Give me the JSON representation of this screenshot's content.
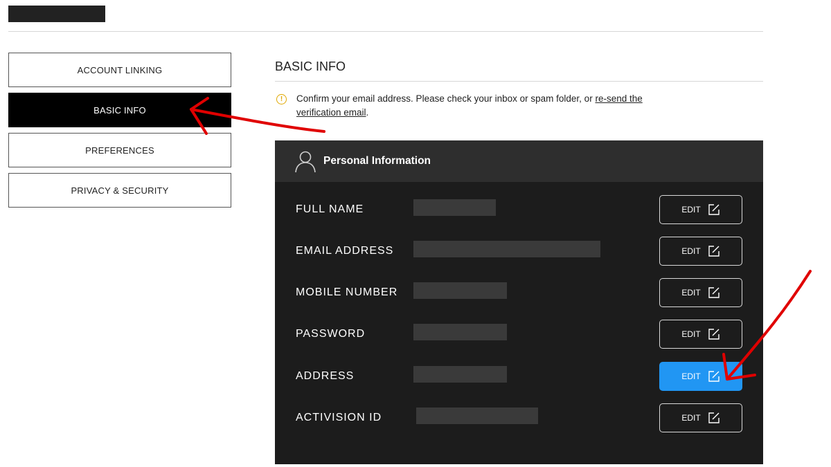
{
  "sidebar": {
    "items": [
      {
        "label": "ACCOUNT LINKING"
      },
      {
        "label": "BASIC INFO"
      },
      {
        "label": "PREFERENCES"
      },
      {
        "label": "PRIVACY & SECURITY"
      }
    ]
  },
  "main": {
    "title": "BASIC INFO",
    "notice": {
      "text": "Confirm your email address. Please check your inbox or spam folder, or ",
      "link": "re-send the verification email",
      "end": "."
    },
    "panel": {
      "title": "Personal Information",
      "rows": [
        {
          "label": "FULL NAME",
          "edit": "EDIT"
        },
        {
          "label": "EMAIL ADDRESS",
          "edit": "EDIT"
        },
        {
          "label": "MOBILE NUMBER",
          "edit": "EDIT"
        },
        {
          "label": "PASSWORD",
          "edit": "EDIT"
        },
        {
          "label": "ADDRESS",
          "edit": "EDIT"
        },
        {
          "label": "ACTIVISION ID",
          "edit": "EDIT"
        }
      ]
    }
  },
  "colors": {
    "active_nav": "#000000",
    "panel_bg": "#1c1c1c",
    "highlight_button": "#2196f3",
    "annotation_arrow": "#e00000",
    "warning_icon": "#e0a800"
  },
  "icons": [
    "info-icon",
    "person-icon",
    "edit-icon"
  ]
}
